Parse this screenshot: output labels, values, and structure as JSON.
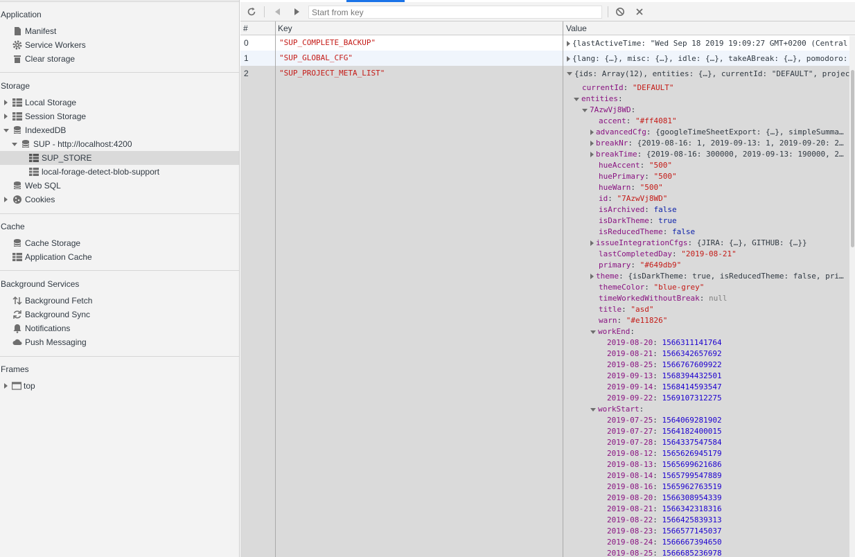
{
  "sidebar": {
    "application": {
      "title": "Application",
      "items": [
        {
          "label": "Manifest",
          "icon": "document-icon"
        },
        {
          "label": "Service Workers",
          "icon": "gear-icon"
        },
        {
          "label": "Clear storage",
          "icon": "trash-icon"
        }
      ]
    },
    "storage": {
      "title": "Storage",
      "local_storage": "Local Storage",
      "session_storage": "Session Storage",
      "indexeddb": "IndexedDB",
      "db_name": "SUP - http://localhost:4200",
      "store_selected": "SUP_STORE",
      "store_other": "local-forage-detect-blob-support",
      "web_sql": "Web SQL",
      "cookies": "Cookies"
    },
    "cache": {
      "title": "Cache",
      "cache_storage": "Cache Storage",
      "application_cache": "Application Cache"
    },
    "background": {
      "title": "Background Services",
      "fetch": "Background Fetch",
      "sync": "Background Sync",
      "notifications": "Notifications",
      "push": "Push Messaging"
    },
    "frames": {
      "title": "Frames",
      "top": "top"
    }
  },
  "toolbar": {
    "search_placeholder": "Start from key"
  },
  "table": {
    "headers": {
      "num": "#",
      "key": "Key",
      "value": "Value"
    },
    "rows": [
      {
        "num": "0",
        "key": "\"SUP_COMPLETE_BACKUP\"",
        "value": "{lastActiveTime: \"Wed Sep 18 2019 19:09:27 GMT+0200 (Central"
      },
      {
        "num": "1",
        "key": "\"SUP_GLOBAL_CFG\"",
        "value": "{lang: {…}, misc: {…}, idle: {…}, takeABreak: {…}, pomodoro:"
      },
      {
        "num": "2",
        "key": "\"SUP_PROJECT_META_LIST\"",
        "value": "{ids: Array(12), entities: {…}, currentId: \"DEFAULT\", projec"
      }
    ]
  },
  "tree": {
    "currentId": {
      "k": "currentId",
      "v": "\"DEFAULT\""
    },
    "entities": "entities",
    "entity_id": "7AzwVj8WD",
    "props": [
      {
        "k": "accent",
        "v": "\"#ff4081\"",
        "t": "str"
      },
      {
        "k": "advancedCfg",
        "v": "{googleTimeSheetExport: {…}, simpleSumma…",
        "t": "plain",
        "exp": true
      },
      {
        "k": "breakNr",
        "v": "{2019-08-16: 1, 2019-09-13: 1, 2019-09-20: 2…",
        "t": "plain",
        "exp": true
      },
      {
        "k": "breakTime",
        "v": "{2019-08-16: 300000, 2019-09-13: 190000, 2…",
        "t": "plain",
        "exp": true
      },
      {
        "k": "hueAccent",
        "v": "\"500\"",
        "t": "str"
      },
      {
        "k": "huePrimary",
        "v": "\"500\"",
        "t": "str"
      },
      {
        "k": "hueWarn",
        "v": "\"500\"",
        "t": "str"
      },
      {
        "k": "id",
        "v": "\"7AzwVj8WD\"",
        "t": "str"
      },
      {
        "k": "isArchived",
        "v": "false",
        "t": "bool"
      },
      {
        "k": "isDarkTheme",
        "v": "true",
        "t": "bool"
      },
      {
        "k": "isReducedTheme",
        "v": "false",
        "t": "bool"
      },
      {
        "k": "issueIntegrationCfgs",
        "v": "{JIRA: {…}, GITHUB: {…}}",
        "t": "plain",
        "exp": true
      },
      {
        "k": "lastCompletedDay",
        "v": "\"2019-08-21\"",
        "t": "str"
      },
      {
        "k": "primary",
        "v": "\"#649db9\"",
        "t": "str"
      },
      {
        "k": "theme",
        "v": "{isDarkTheme: true, isReducedTheme: false, pri…",
        "t": "plain",
        "exp": true
      },
      {
        "k": "themeColor",
        "v": "\"blue-grey\"",
        "t": "str"
      },
      {
        "k": "timeWorkedWithoutBreak",
        "v": "null",
        "t": "nul"
      },
      {
        "k": "title",
        "v": "\"asd\"",
        "t": "str"
      },
      {
        "k": "warn",
        "v": "\"#e11826\"",
        "t": "str"
      }
    ],
    "workEnd": {
      "label": "workEnd",
      "entries": [
        {
          "d": "2019-08-20",
          "v": "1566311141764"
        },
        {
          "d": "2019-08-21",
          "v": "1566342657692"
        },
        {
          "d": "2019-08-25",
          "v": "1566767609922"
        },
        {
          "d": "2019-09-13",
          "v": "1568394432501"
        },
        {
          "d": "2019-09-14",
          "v": "1568414593547"
        },
        {
          "d": "2019-09-22",
          "v": "1569107312275"
        }
      ]
    },
    "workStart": {
      "label": "workStart",
      "entries": [
        {
          "d": "2019-07-25",
          "v": "1564069281902"
        },
        {
          "d": "2019-07-27",
          "v": "1564182400015"
        },
        {
          "d": "2019-07-28",
          "v": "1564337547584"
        },
        {
          "d": "2019-08-12",
          "v": "1565626945179"
        },
        {
          "d": "2019-08-13",
          "v": "1565699621686"
        },
        {
          "d": "2019-08-14",
          "v": "1565799547889"
        },
        {
          "d": "2019-08-16",
          "v": "1565962763519"
        },
        {
          "d": "2019-08-20",
          "v": "1566308954339"
        },
        {
          "d": "2019-08-21",
          "v": "1566342318316"
        },
        {
          "d": "2019-08-22",
          "v": "1566425839313"
        },
        {
          "d": "2019-08-23",
          "v": "1566577145037"
        },
        {
          "d": "2019-08-24",
          "v": "1566667394650"
        },
        {
          "d": "2019-08-25",
          "v": "1566685236978"
        }
      ]
    }
  }
}
